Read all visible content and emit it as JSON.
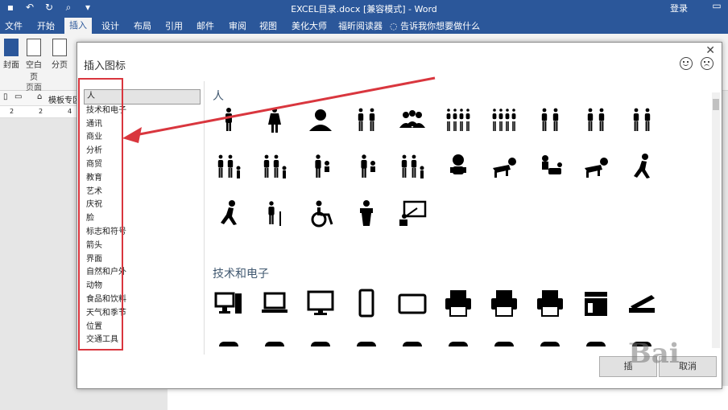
{
  "window": {
    "title": "EXCEL目录.docx [兼容模式] - Word",
    "login": "登录"
  },
  "ribbon": {
    "tabs": [
      "文件",
      "开始",
      "插入",
      "设计",
      "布局",
      "引用",
      "邮件",
      "审阅",
      "视图",
      "美化大师",
      "福昕阅读器"
    ],
    "active_tab": "插入",
    "tell_me": "告诉我你想要做什么",
    "buttons": {
      "cover": "封面",
      "blank": "空白页",
      "break": "分页"
    },
    "group_label": "页面"
  },
  "nav": {
    "template": "模板专区"
  },
  "ruler": {
    "marks": [
      "2",
      "2",
      "4"
    ]
  },
  "dialog": {
    "title": "插入图标",
    "categories": [
      "人",
      "技术和电子",
      "通讯",
      "商业",
      "分析",
      "商贸",
      "教育",
      "艺术",
      "庆祝",
      "脸",
      "标志和符号",
      "箭头",
      "界面",
      "自然和户外",
      "动物",
      "食品和饮料",
      "天气和季节",
      "位置",
      "交通工具"
    ],
    "selected_category": "人",
    "sections": [
      "人",
      "技术和电子"
    ],
    "insert_label": "插",
    "cancel_label": "取消"
  },
  "colors": {
    "accent": "#2b579a",
    "annotation": "#d9363e"
  },
  "icons": {
    "people": [
      "man-icon",
      "woman-icon",
      "person-bust-icon",
      "group-icon",
      "group-meeting-icon",
      "crowd-icon",
      "crowd-women-icon",
      "couple-icon",
      "couple-women-icon",
      "couple-men-icon",
      "family-icon",
      "family-child-icon",
      "parent-baby-icon",
      "father-child-icon",
      "family-walk-icon",
      "baby-icon",
      "crawling-baby-icon",
      "diaper-change-icon",
      "crawling-adult-icon",
      "walking-icon",
      "running-icon",
      "elderly-cane-icon",
      "wheelchair-icon",
      "speaker-podium-icon",
      "presenter-board-icon"
    ],
    "tech": [
      "desktop-computer-icon",
      "laptop-icon",
      "monitor-icon",
      "smartphone-icon",
      "tablet-icon",
      "printer-icon",
      "fax-icon",
      "shredder-icon",
      "copier-icon",
      "scanner-icon"
    ]
  },
  "watermark": "Bai"
}
